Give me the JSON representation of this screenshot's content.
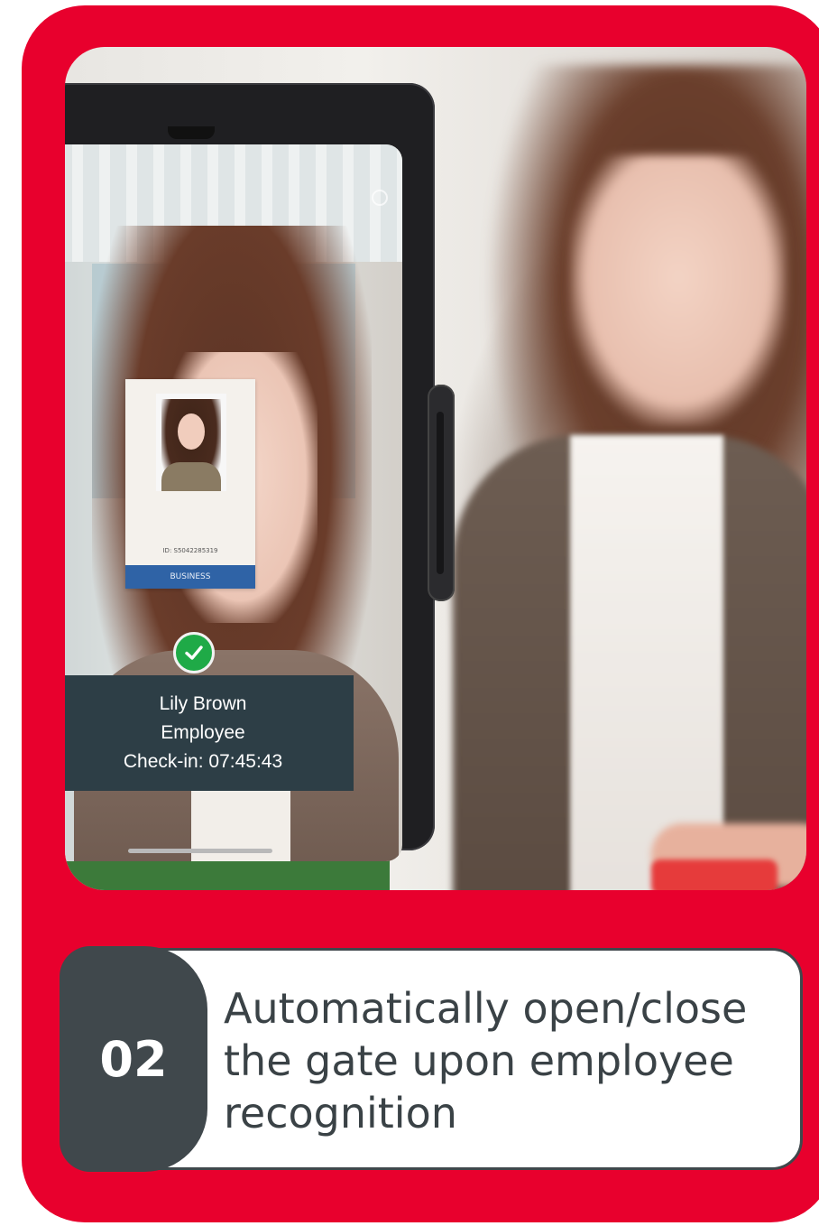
{
  "photo": {
    "id_card": {
      "id_text": "ID: S5042285319",
      "band_label": "BUSINESS"
    },
    "recognition": {
      "name": "Lily Brown",
      "role": "Employee",
      "checkin": "Check-in: 07:45:43",
      "status_icon": "check-circle-icon"
    }
  },
  "caption": {
    "number": "02",
    "line1": "Automatically open/close",
    "line2": "the gate upon employee",
    "line3": "recognition"
  },
  "colors": {
    "frame": "#e8002d",
    "caption_tab": "#40484c",
    "info_box": "#2d3e46",
    "check": "#1faa47",
    "id_band": "#2f63a6"
  }
}
